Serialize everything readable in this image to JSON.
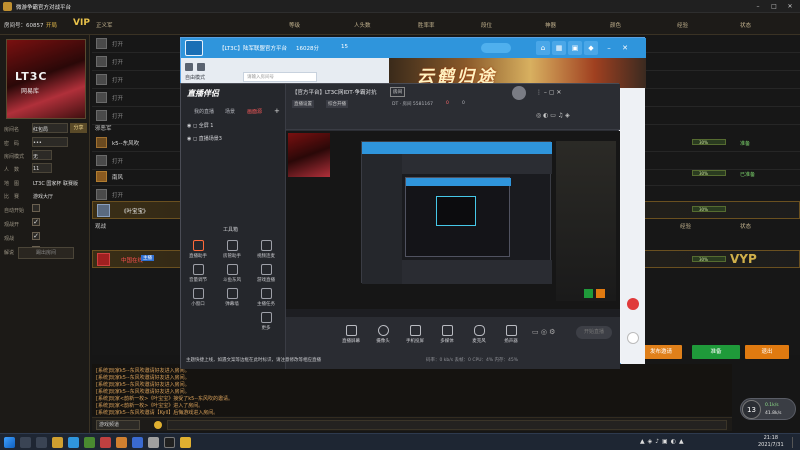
{
  "game": {
    "title": "微游争霸官方对战平台",
    "room_number": "房间号：60857",
    "room_flag": "开局",
    "vip": "VIP",
    "team_label": "正义军",
    "columns": [
      "等级",
      "人头数",
      "胜率率",
      "段位",
      "神器",
      "颜色",
      "经验",
      "状态"
    ],
    "profile": [
      {
        "label": "房间名",
        "value": "红包局",
        "extra": "分享"
      },
      {
        "label": "密　码",
        "value": "•••"
      },
      {
        "label": "房间模式",
        "value": "无"
      },
      {
        "label": "人　数",
        "value": "11"
      },
      {
        "label": "地　图",
        "value": "LT3C 国家杯 联赛版"
      },
      {
        "label": "比　赛",
        "value": "游戏大厅"
      },
      {
        "label": "自动开始",
        "value": ""
      },
      {
        "label": "观战开",
        "value": "✓"
      },
      {
        "label": "观战",
        "value": "✓"
      },
      {
        "label": "解说",
        "value": "✓"
      }
    ],
    "avatar_label": "LT3C",
    "avatar_sub": "网易库",
    "left_footer": "踢出房间",
    "empty_slot": "打开",
    "section_enemy": "邪恶军",
    "section_other": "观战",
    "players": [
      {
        "name": "k5--东风吹"
      },
      {
        "name": "南风"
      },
      {
        "name": "《叶宝宝》"
      },
      {
        "name": "中国在线",
        "tag": "主播"
      }
    ],
    "status_values": [
      "准备",
      "已准备"
    ],
    "progress_values": [
      "30%",
      "30%",
      "30%",
      "30%"
    ],
    "vyp": "VYP",
    "chat_lines": [
      "[系统]玩家k5--东风吹邀请好友进入房间。",
      "[系统]玩家k5--东风吹邀请好友进入房间。",
      "[系统]玩家k5--东风吹邀请好友进入房间。",
      "[系统]玩家k5--东风吹邀请好友进入房间。",
      "[系统]玩家<韵新一枚>《叶宝宝》接受了k5--东风吹的邀请。",
      "[系统]玩家<韵新一枚>《叶宝宝》进入了房间。",
      "[系统]玩家k5--东风吹邀请【Kyll】后悔游戏进入房间。"
    ],
    "chat_channel": "游戏频道",
    "buttons": {
      "invite": "发布邀请",
      "ready": "准备",
      "leave": "退出"
    },
    "level_badge": "13",
    "net_up": "0.1k/s",
    "net_down": "41.8k/s"
  },
  "stream_outer": {
    "title": "【LT3C】陆军联盟官方平台",
    "score": "16028分",
    "viewers": "15",
    "mode": "自由模式",
    "search_placeholder": "请输入房间号"
  },
  "stream_inner": {
    "brand": "直播伴侣",
    "tabs": [
      "我的直播",
      "场景",
      "画面源"
    ],
    "scenes": [
      "全屏 1",
      "直播场景3"
    ],
    "toolbox_title": "工具箱",
    "tools": [
      "直播助手",
      "房管助手",
      "视频连麦",
      "音量调节",
      "斗鱼东风",
      "游戏直播",
      "小窗口",
      "弹幕墙",
      "主播任务",
      "更多"
    ],
    "stream_title": "【官方平台】LT3C网IDT·争霸对抗",
    "room_badge": "房间",
    "sub_items": [
      "直播设置",
      "综合开播"
    ],
    "room_id": "DT · 房间 5581167",
    "likes": "0",
    "fans": "0",
    "bottom_tools": [
      "直播屏幕",
      "摄像头",
      "手机投屏",
      "多媒体",
      "麦克风",
      "扬声器"
    ],
    "start_label": "开始直播",
    "notice": "主题快捷上线，如遇文案等边框在此时标识，请注意修改等相应直播",
    "stats": "码率：0 kb/s  丢帧：0  CPU：4%  内存：45%"
  },
  "taskbar": {
    "time": "21:18",
    "date": "2021/7/31"
  },
  "colors": {
    "titlebar_blue": "#2f95dc",
    "gold": "#e8c24a",
    "ready_green": "#1f9a3a",
    "invite_orange": "#e0801a",
    "leave_orange": "#e07a10"
  }
}
